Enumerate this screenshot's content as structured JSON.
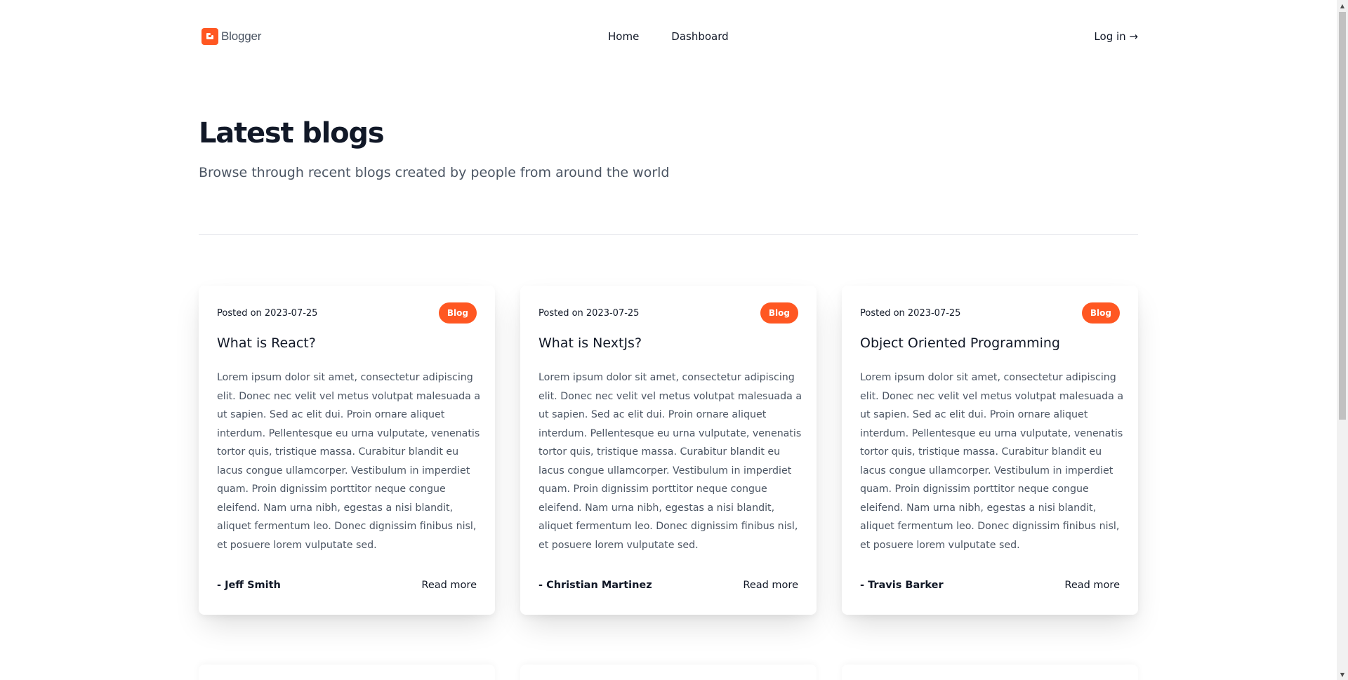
{
  "header": {
    "logo_text": "Blogger",
    "logo_icon": "blogger-logo-icon",
    "nav": [
      {
        "label": "Home"
      },
      {
        "label": "Dashboard"
      }
    ],
    "login_label": "Log in →"
  },
  "hero": {
    "title": "Latest blogs",
    "subtitle": "Browse through recent blogs created by people from around the world"
  },
  "colors": {
    "accent": "#ff5722",
    "text": "#111827",
    "muted": "#4b5563"
  },
  "posts": [
    {
      "posted": "Posted on 2023-07-25",
      "badge": "Blog",
      "title": "What is React?",
      "body": "Lorem ipsum dolor sit amet, consectetur adipiscing elit. Donec nec velit vel metus volutpat malesuada a ut sapien. Sed ac elit dui. Proin ornare aliquet interdum. Pellentesque eu urna vulputate, venenatis tortor quis, tristique massa. Curabitur blandit eu lacus congue ullamcorper. Vestibulum in imperdiet quam. Proin dignissim porttitor neque congue eleifend. Nam urna nibh, egestas a nisi blandit, aliquet fermentum leo. Donec dignissim finibus nisl, et posuere lorem vulputate sed.",
      "author": "- Jeff Smith",
      "read_more": "Read more"
    },
    {
      "posted": "Posted on 2023-07-25",
      "badge": "Blog",
      "title": "What is NextJs?",
      "body": "Lorem ipsum dolor sit amet, consectetur adipiscing elit. Donec nec velit vel metus volutpat malesuada a ut sapien. Sed ac elit dui. Proin ornare aliquet interdum. Pellentesque eu urna vulputate, venenatis tortor quis, tristique massa. Curabitur blandit eu lacus congue ullamcorper. Vestibulum in imperdiet quam. Proin dignissim porttitor neque congue eleifend. Nam urna nibh, egestas a nisi blandit, aliquet fermentum leo. Donec dignissim finibus nisl, et posuere lorem vulputate sed.",
      "author": "- Christian Martinez",
      "read_more": "Read more"
    },
    {
      "posted": "Posted on 2023-07-25",
      "badge": "Blog",
      "title": "Object Oriented Programming",
      "body": "Lorem ipsum dolor sit amet, consectetur adipiscing elit. Donec nec velit vel metus volutpat malesuada a ut sapien. Sed ac elit dui. Proin ornare aliquet interdum. Pellentesque eu urna vulputate, venenatis tortor quis, tristique massa. Curabitur blandit eu lacus congue ullamcorper. Vestibulum in imperdiet quam. Proin dignissim porttitor neque congue eleifend. Nam urna nibh, egestas a nisi blandit, aliquet fermentum leo. Donec dignissim finibus nisl, et posuere lorem vulputate sed.",
      "author": "- Travis Barker",
      "read_more": "Read more"
    }
  ]
}
